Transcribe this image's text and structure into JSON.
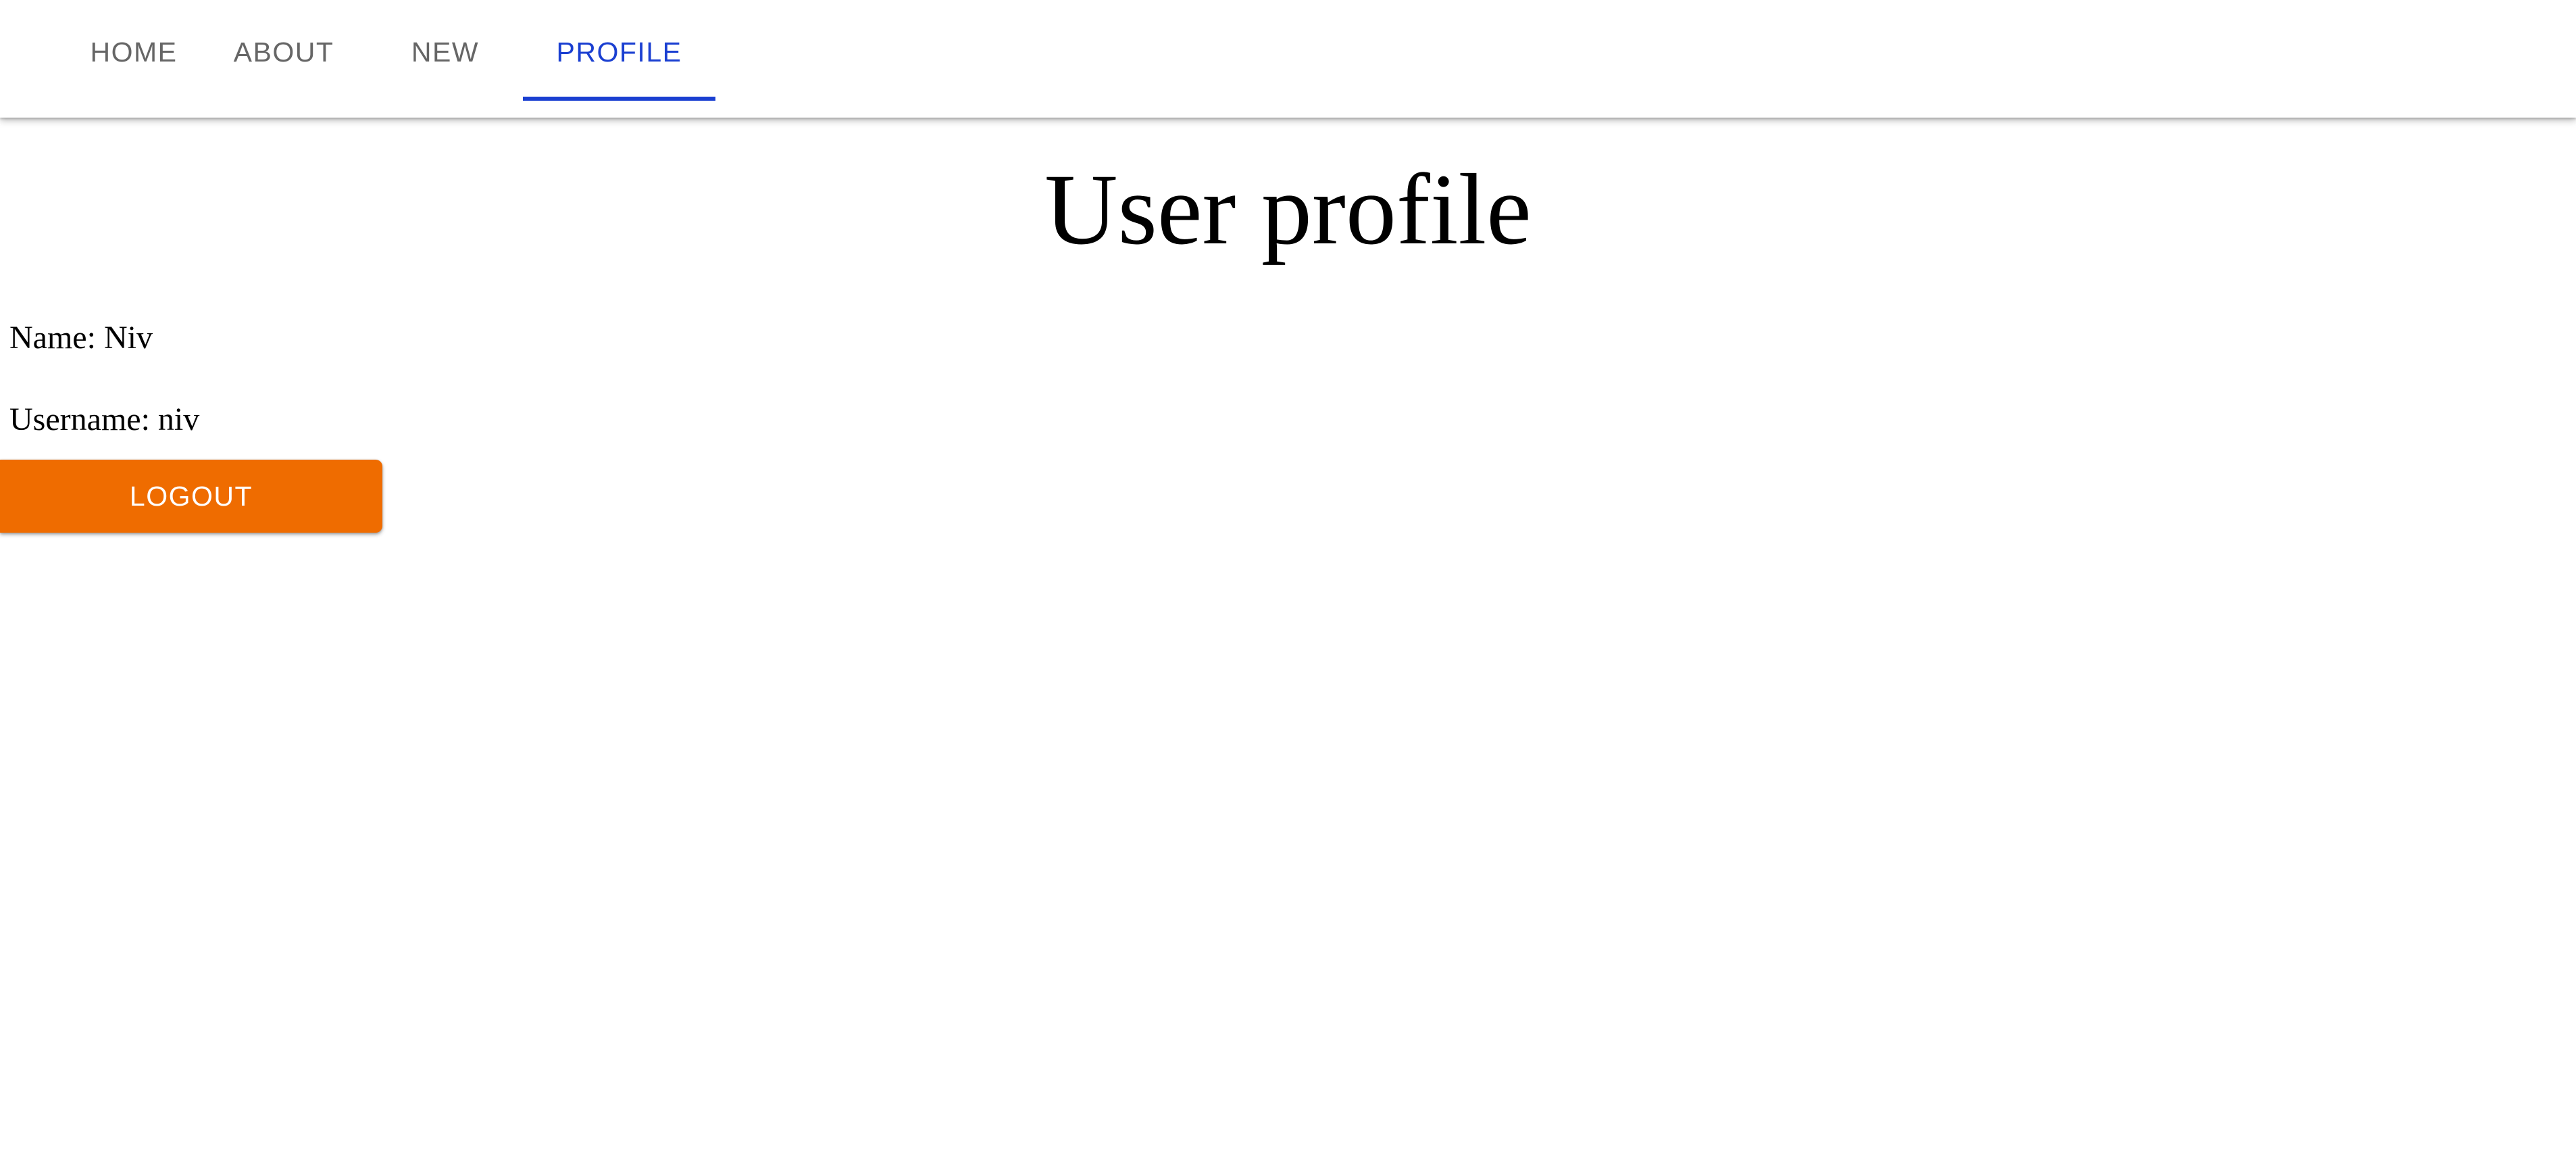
{
  "nav": {
    "tabs": [
      {
        "label": "HOME",
        "active": false
      },
      {
        "label": "ABOUT",
        "active": false
      },
      {
        "label": "NEW",
        "active": false
      },
      {
        "label": "PROFILE",
        "active": true
      }
    ]
  },
  "profile": {
    "title": "User profile",
    "name_text": "Name: Niv",
    "username_text": "Username: niv",
    "logout_label": "LOGOUT"
  },
  "colors": {
    "accent": "#1a3fd1",
    "logout_button": "#ef6c00",
    "tab_inactive": "#666666"
  }
}
